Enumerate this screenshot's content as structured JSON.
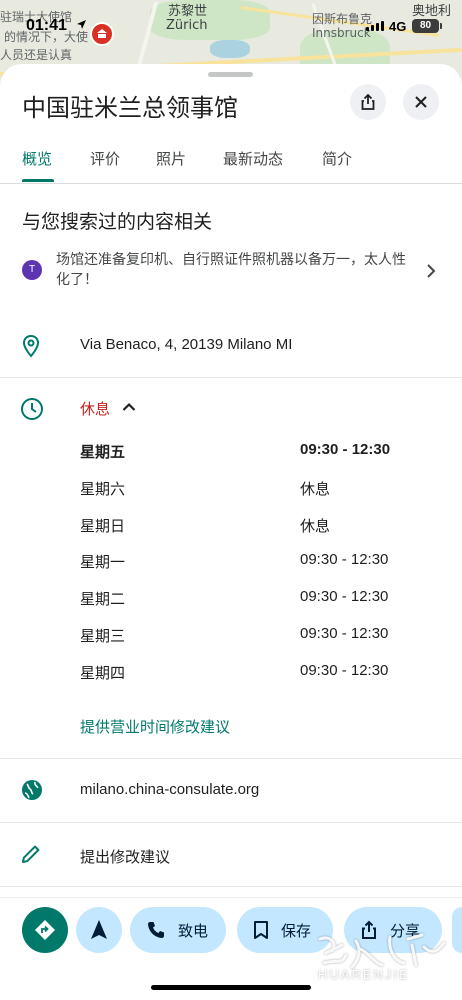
{
  "map": {
    "labels": [
      "驻瑞士大使馆",
      "的情况下，大使",
      "人员还是认真",
      "苏黎世",
      "Zürich",
      "因斯布鲁克",
      "Innsbruck",
      "奥地利"
    ]
  },
  "status_bar": {
    "time": "01:41",
    "network": "4G",
    "battery": "80"
  },
  "place": {
    "title": "中国驻米兰总领事馆"
  },
  "tabs": [
    {
      "label": "概览",
      "active": true
    },
    {
      "label": "评价",
      "active": false
    },
    {
      "label": "照片",
      "active": false
    },
    {
      "label": "最新动态",
      "active": false
    },
    {
      "label": "简介",
      "active": false
    }
  ],
  "related": {
    "title": "与您搜索过的内容相关",
    "avatar_letter": "T",
    "review_text": "场馆还准备复印机、自行照证件照机器以备万一，太人性化了！"
  },
  "address": "Via Benaco, 4, 20139 Milano MI",
  "hours": {
    "status": "休息",
    "rows": [
      {
        "day": "星期五",
        "time": "09:30 - 12:30",
        "today": true
      },
      {
        "day": "星期六",
        "time": "休息",
        "today": false
      },
      {
        "day": "星期日",
        "time": "休息",
        "today": false
      },
      {
        "day": "星期一",
        "time": "09:30 - 12:30",
        "today": false
      },
      {
        "day": "星期二",
        "time": "09:30 - 12:30",
        "today": false
      },
      {
        "day": "星期三",
        "time": "09:30 - 12:30",
        "today": false
      },
      {
        "day": "星期四",
        "time": "09:30 - 12:30",
        "today": false
      }
    ],
    "suggest_label": "提供营业时间修改建议"
  },
  "website": "milano.china-consulate.org",
  "suggest_edit": "提出修改建议",
  "actions": {
    "call": "致电",
    "save": "保存",
    "share": "分享"
  },
  "watermark": "HUARENJIE",
  "colors": {
    "accent": "#00796b",
    "closed": "#c5221f",
    "pill_bg": "#c2e7ff"
  }
}
